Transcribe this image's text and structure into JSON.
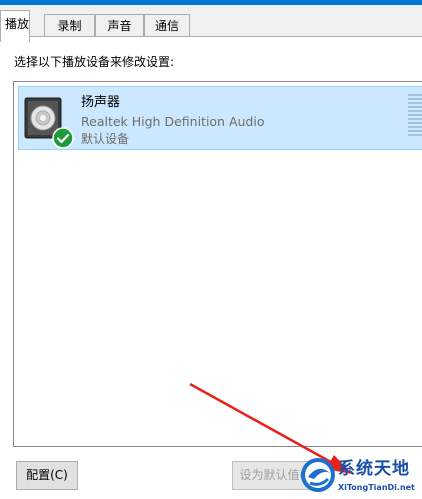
{
  "tabs": [
    {
      "label": "播放",
      "active": true
    },
    {
      "label": "录制",
      "active": false
    },
    {
      "label": "声音",
      "active": false
    },
    {
      "label": "通信",
      "active": false
    }
  ],
  "instruction": "选择以下播放设备来修改设置:",
  "devices": [
    {
      "name": "扬声器",
      "description": "Realtek High Definition Audio",
      "status": "默认设备",
      "icon": "speaker-icon",
      "badge": "default-check-icon",
      "selected": true
    }
  ],
  "buttons": {
    "configure": "配置(C)",
    "set_default": "设为默认值(S)"
  },
  "watermark": {
    "title": "系统天地",
    "url": "XiTongTianDi.net"
  },
  "colors": {
    "accent": "#0078d7",
    "selection": "#cce8ff",
    "arrow": "#e8221b",
    "check": "#1e9c3a"
  }
}
